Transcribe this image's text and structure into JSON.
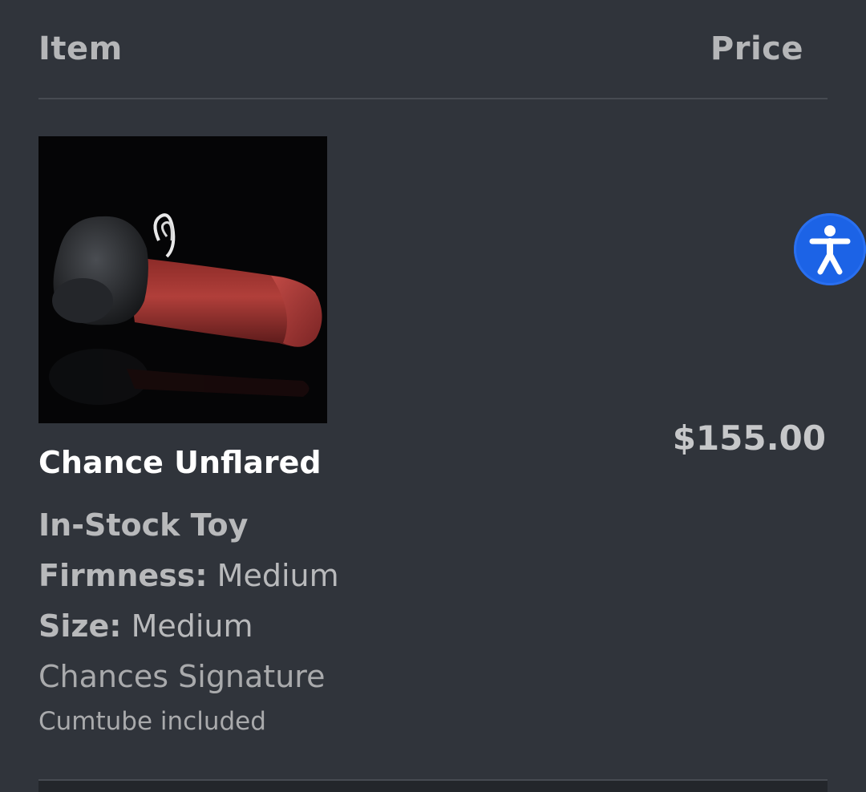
{
  "header": {
    "item_label": "Item",
    "price_label": "Price"
  },
  "product": {
    "title": "Chance Unflared",
    "price": "$155.00",
    "stock_type": "In-Stock Toy",
    "firmness_label": "Firmness:",
    "firmness_value": "Medium",
    "size_label": "Size:",
    "size_value": "Medium",
    "option": "Chances Signature",
    "extra": "Cumtube included"
  },
  "accessibility_widget": {
    "icon": "accessibility-icon",
    "color": "#1c63e6"
  },
  "colors": {
    "background": "#30343b",
    "heading_text": "#b5b6b8",
    "title_text": "#ffffff"
  }
}
